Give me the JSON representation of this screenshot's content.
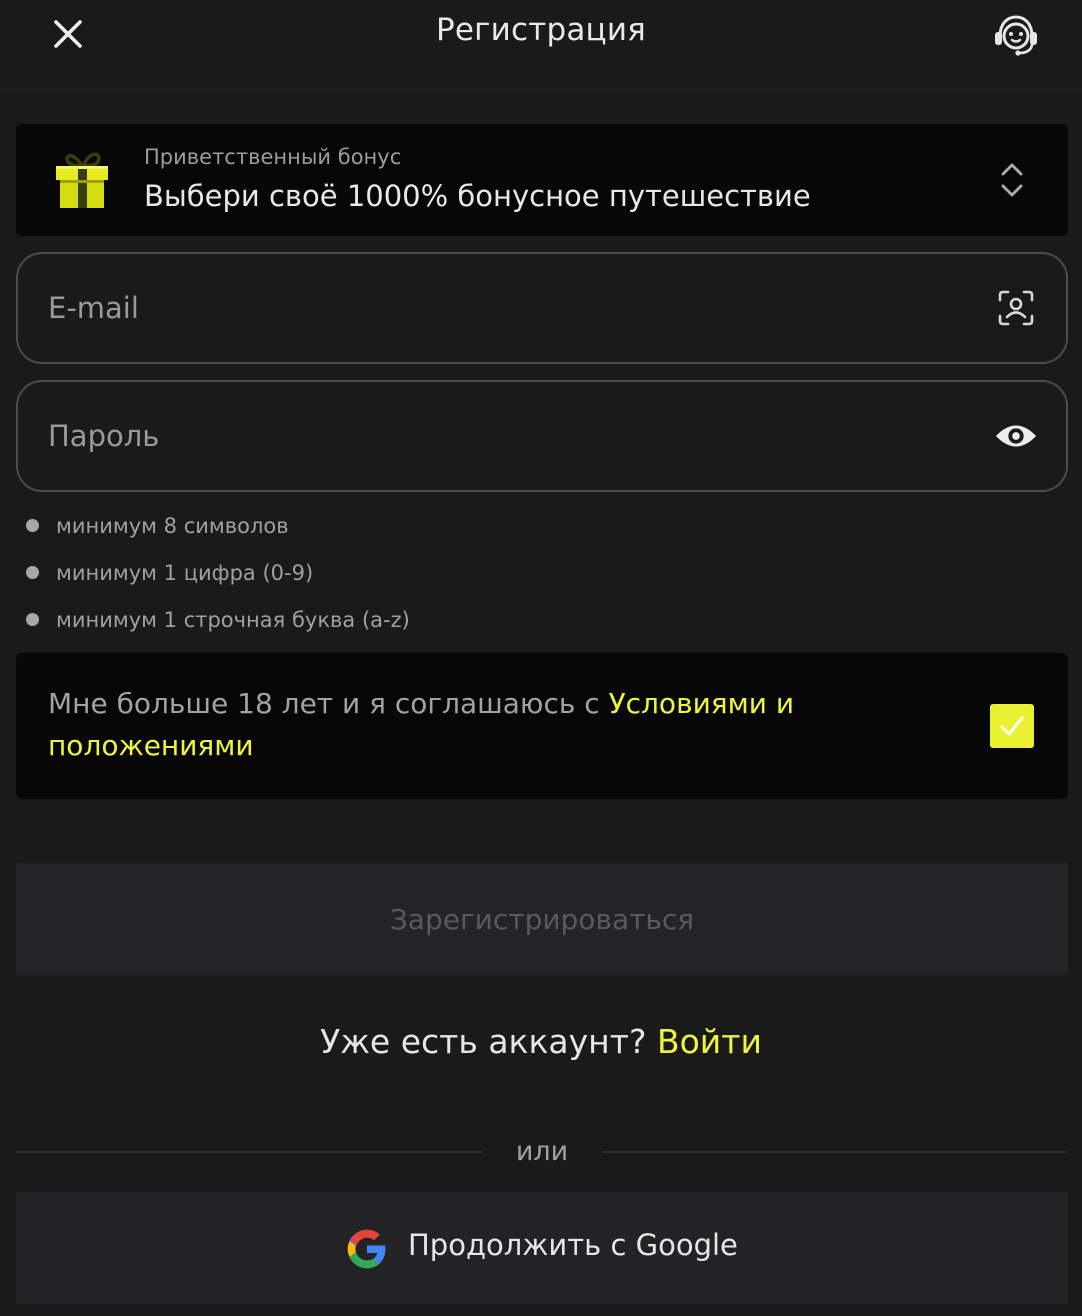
{
  "header": {
    "title": "Регистрация"
  },
  "bonus": {
    "caption": "Приветственный бонус",
    "value": "Выбери своё 1000% бонусное путешествие"
  },
  "fields": {
    "email_placeholder": "E-mail",
    "password_placeholder": "Пароль"
  },
  "password_requirements": [
    "минимум 8 символов",
    "минимум 1 цифра (0-9)",
    "минимум 1 строчная буква (a-z)"
  ],
  "terms": {
    "text": "Мне больше 18 лет и я соглашаюсь с ",
    "link": "Условиями и положениями",
    "checked": true
  },
  "register_button": "Зарегистрироваться",
  "login": {
    "question": "Уже есть аккаунт?",
    "link": "Войти"
  },
  "divider": "или",
  "google_button": "Продолжить с Google",
  "colors": {
    "background": "#1a1a1b",
    "accent": "#eff43e",
    "panel": "#070707",
    "button_disabled": "#242426"
  },
  "icons": {
    "close": "close-icon",
    "support": "headset-icon",
    "gift": "gift-icon",
    "selector": "chevron-up-down-icon",
    "email": "face-scan-icon",
    "password": "eye-icon",
    "check": "check-icon",
    "google": "google-icon"
  }
}
